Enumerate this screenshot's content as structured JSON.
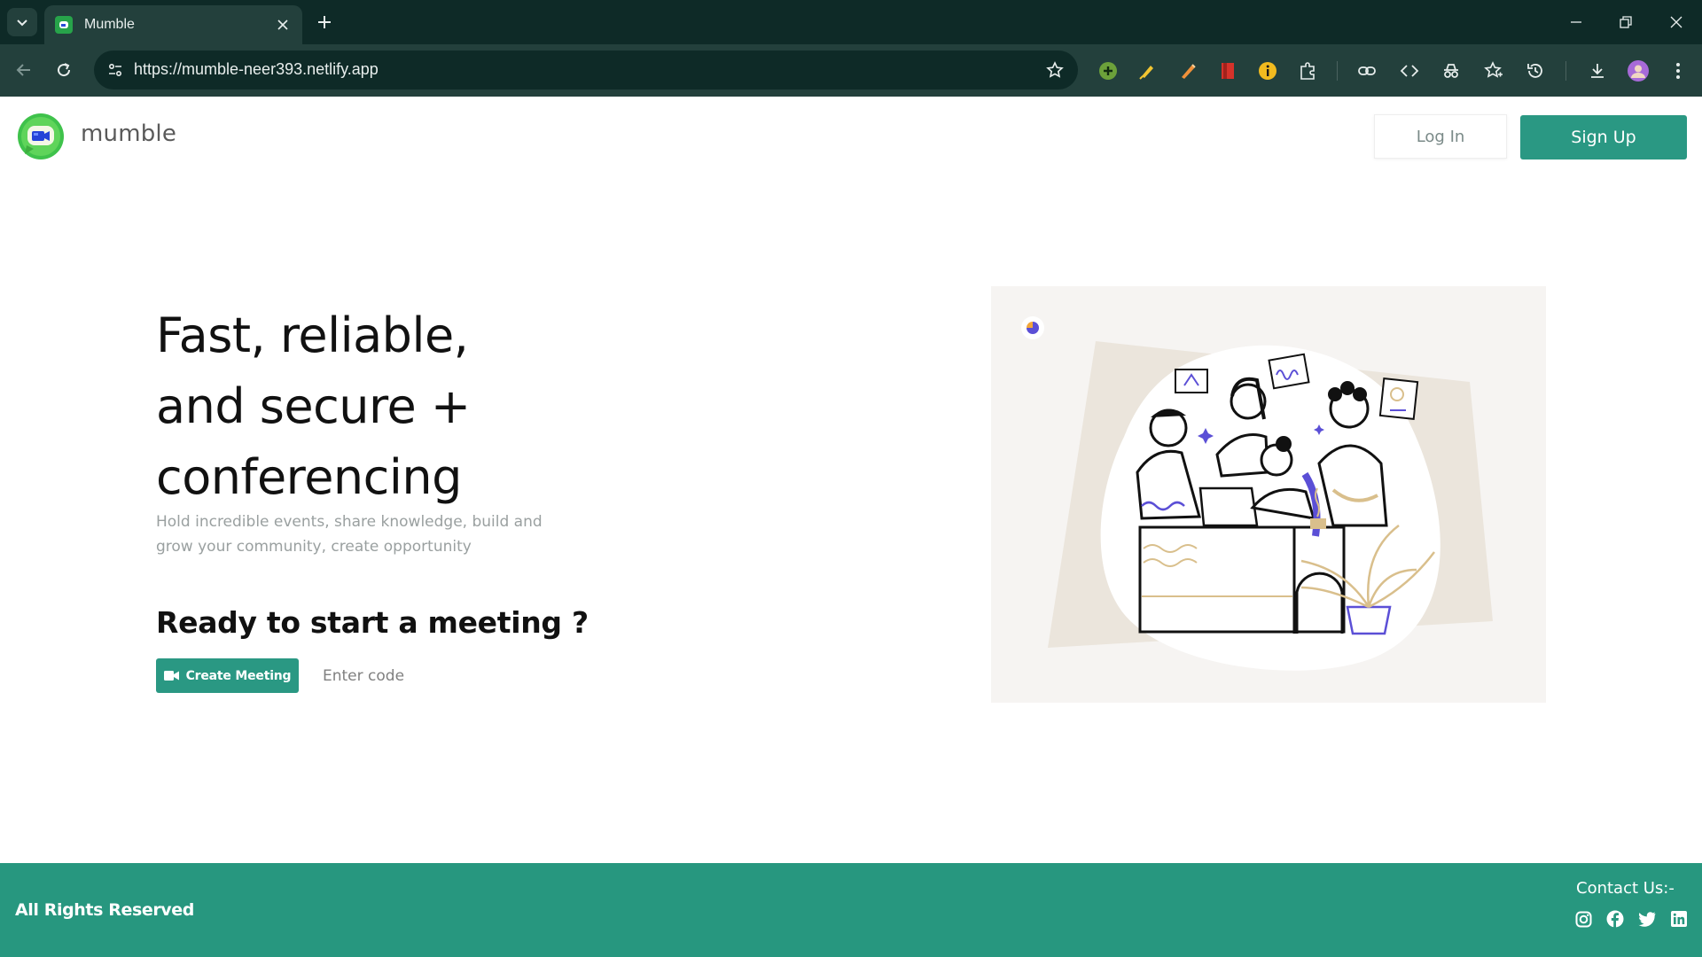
{
  "browser": {
    "tab_title": "Mumble",
    "url": "https://mumble-neer393.netlify.app",
    "colors": {
      "frame": "#0e2a27",
      "toolbar": "#23403c",
      "text": "#e8eeed"
    },
    "extension_icons": [
      "add-extension-icon",
      "highlighter-icon",
      "pencil-icon",
      "bookmark-red-icon",
      "info-icon",
      "puzzle-icon",
      "link-icon",
      "code-icon",
      "incognito-icon",
      "favorites-icon",
      "history-icon",
      "download-icon",
      "profile-avatar-icon",
      "more-menu-icon"
    ]
  },
  "header": {
    "brand": "mumble",
    "login_label": "Log In",
    "signup_label": "Sign Up"
  },
  "hero": {
    "title_lines": [
      "Fast, reliable,",
      "and secure +",
      "conferencing"
    ],
    "subtitle": "Hold incredible events, share knowledge, build and grow your community, create opportunity",
    "ready_text": "Ready to start a meeting ?",
    "create_label": "Create Meeting",
    "code_placeholder": "Enter code"
  },
  "footer": {
    "rights": "All Rights Reserved",
    "contact": "Contact Us:-",
    "social_icons": [
      "instagram-icon",
      "facebook-icon",
      "twitter-icon",
      "linkedin-icon"
    ]
  },
  "theme": {
    "accent": "#2a9883",
    "footer": "#27977f",
    "illustration_accent": "#5b4fd6",
    "illustration_warm": "#d9bf8c"
  }
}
